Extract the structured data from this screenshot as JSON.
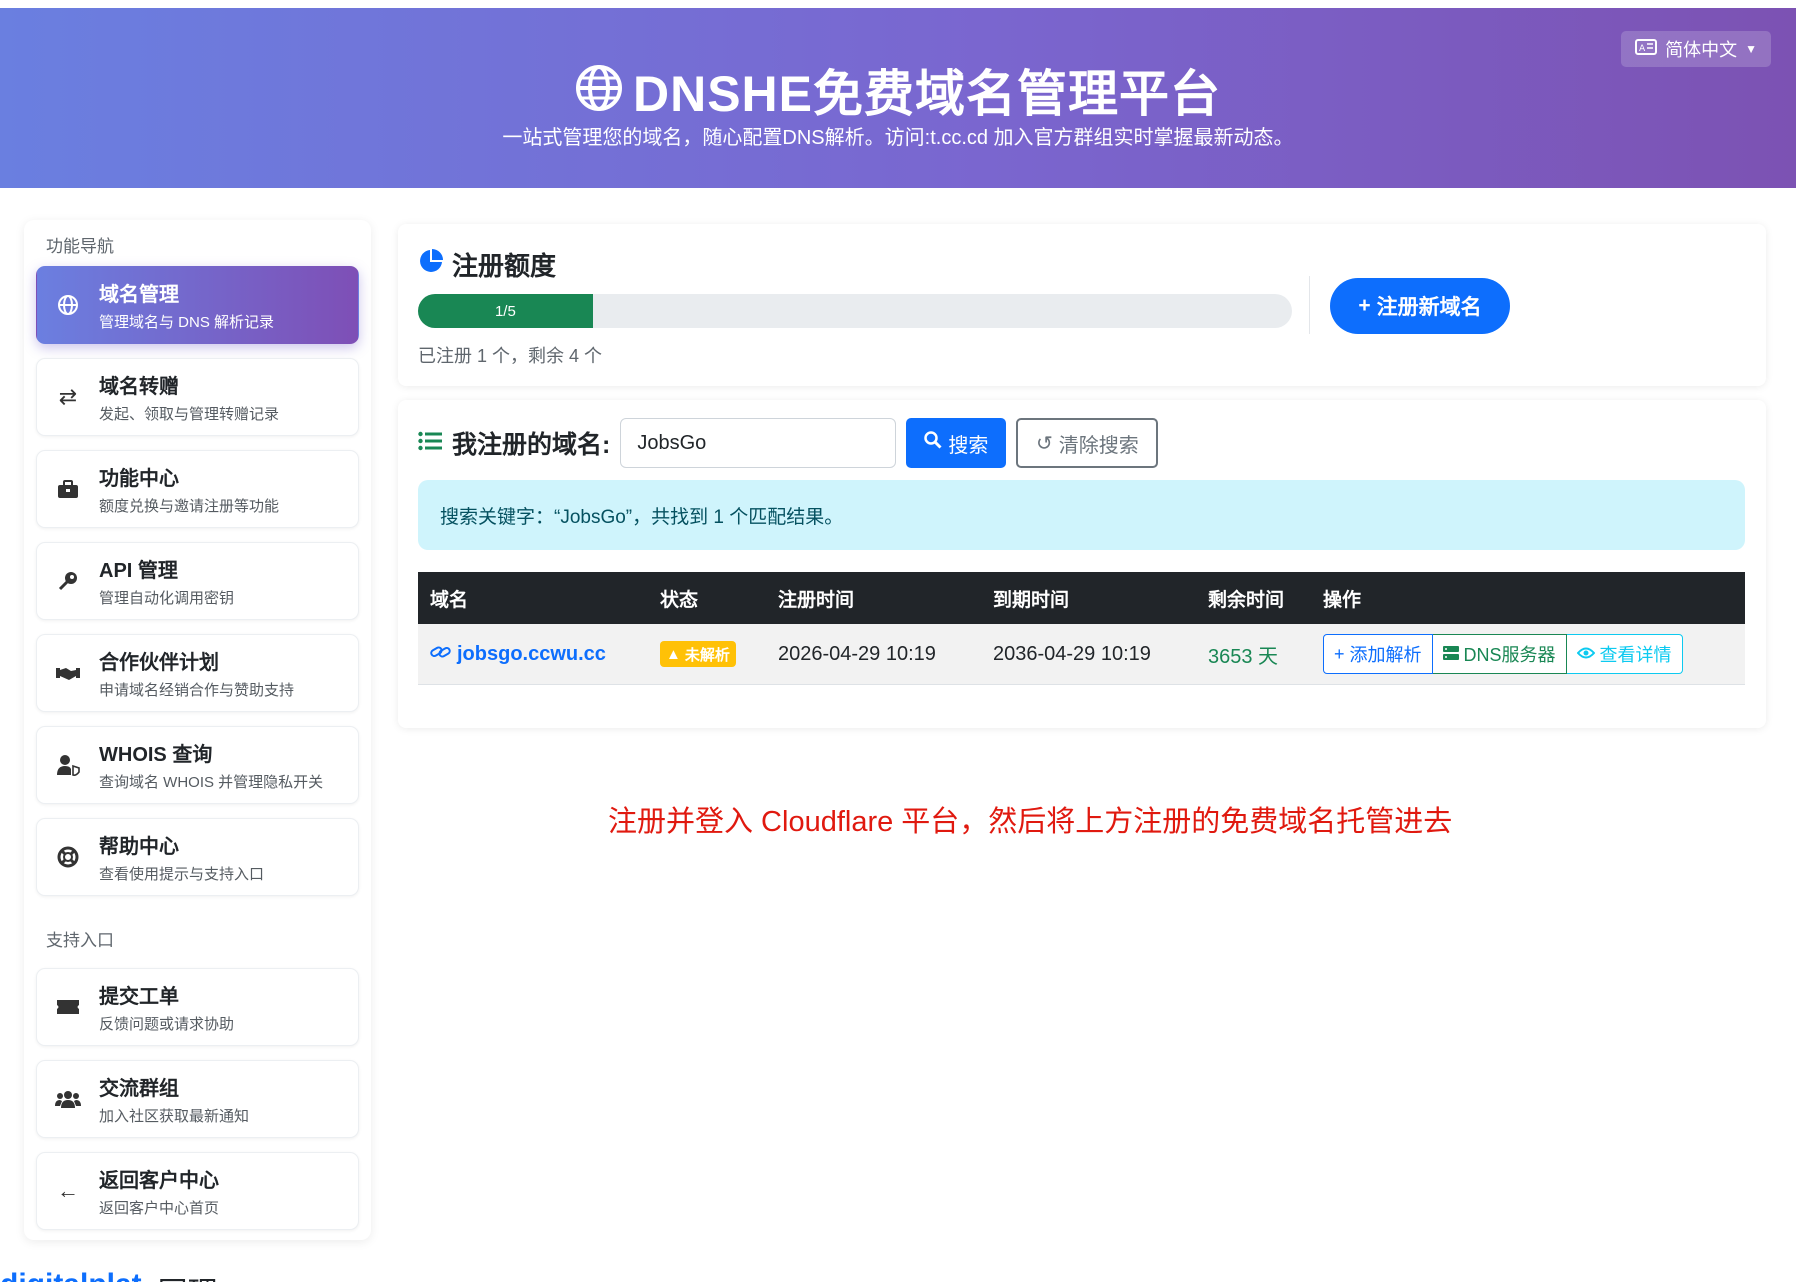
{
  "header": {
    "title": "DNSHE免费域名管理平台",
    "subtitle": "一站式管理您的域名，随心配置DNS解析。访问:t.cc.cd 加入官方群组实时掌握最新动态。",
    "language": "简体中文"
  },
  "sidebar": {
    "section1": "功能导航",
    "section2": "支持入口",
    "items": [
      {
        "title": "域名管理",
        "desc": "管理域名与 DNS 解析记录",
        "icon": "globe-icon",
        "active": true
      },
      {
        "title": "域名转赠",
        "desc": "发起、领取与管理转赠记录",
        "icon": "transfer-arrows-icon"
      },
      {
        "title": "功能中心",
        "desc": "额度兑换与邀请注册等功能",
        "icon": "toolbox-icon"
      },
      {
        "title": "API 管理",
        "desc": "管理自动化调用密钥",
        "icon": "key-icon"
      },
      {
        "title": "合作伙伴计划",
        "desc": "申请域名经销合作与赞助支持",
        "icon": "handshake-icon"
      },
      {
        "title": "WHOIS 查询",
        "desc": "查询域名 WHOIS 并管理隐私开关",
        "icon": "user-shield-icon"
      },
      {
        "title": "帮助中心",
        "desc": "查看使用提示与支持入口",
        "icon": "lifebuoy-icon"
      },
      {
        "title": "提交工单",
        "desc": "反馈问题或请求协助",
        "icon": "ticket-icon"
      },
      {
        "title": "交流群组",
        "desc": "加入社区获取最新通知",
        "icon": "users-icon"
      },
      {
        "title": "返回客户中心",
        "desc": "返回客户中心首页",
        "icon": "arrow-left-icon"
      }
    ]
  },
  "quota": {
    "title": "注册额度",
    "progress_label": "1/5",
    "progress_fraction": 0.2,
    "note": "已注册 1 个，剩余 4 个",
    "register_button": "注册新域名"
  },
  "domains": {
    "title": "我注册的域名:",
    "search_value": "JobsGo",
    "search_button": "搜索",
    "clear_button": "清除搜索",
    "alert": "搜索关键字：“JobsGo”，共找到 1 个匹配结果。",
    "columns": [
      "域名",
      "状态",
      "注册时间",
      "到期时间",
      "剩余时间",
      "操作"
    ],
    "rows": [
      {
        "domain": "jobsgo.ccwu.cc",
        "status": "未解析",
        "registered": "2026-04-29 10:19",
        "expires": "2036-04-29 10:19",
        "remaining": "3653 天",
        "actions": [
          "添加解析",
          "DNS服务器",
          "查看详情"
        ]
      }
    ]
  },
  "annotation": "注册并登入 Cloudflare 平台，然后将上方注册的免费域名托管进去",
  "bottom": {
    "link": "digitalplat",
    "text": "同理"
  },
  "colors": {
    "primary": "#0d6efd",
    "success": "#198754",
    "warning": "#ffc107",
    "info": "#0dcaf0",
    "annotation": "#e0190f"
  }
}
